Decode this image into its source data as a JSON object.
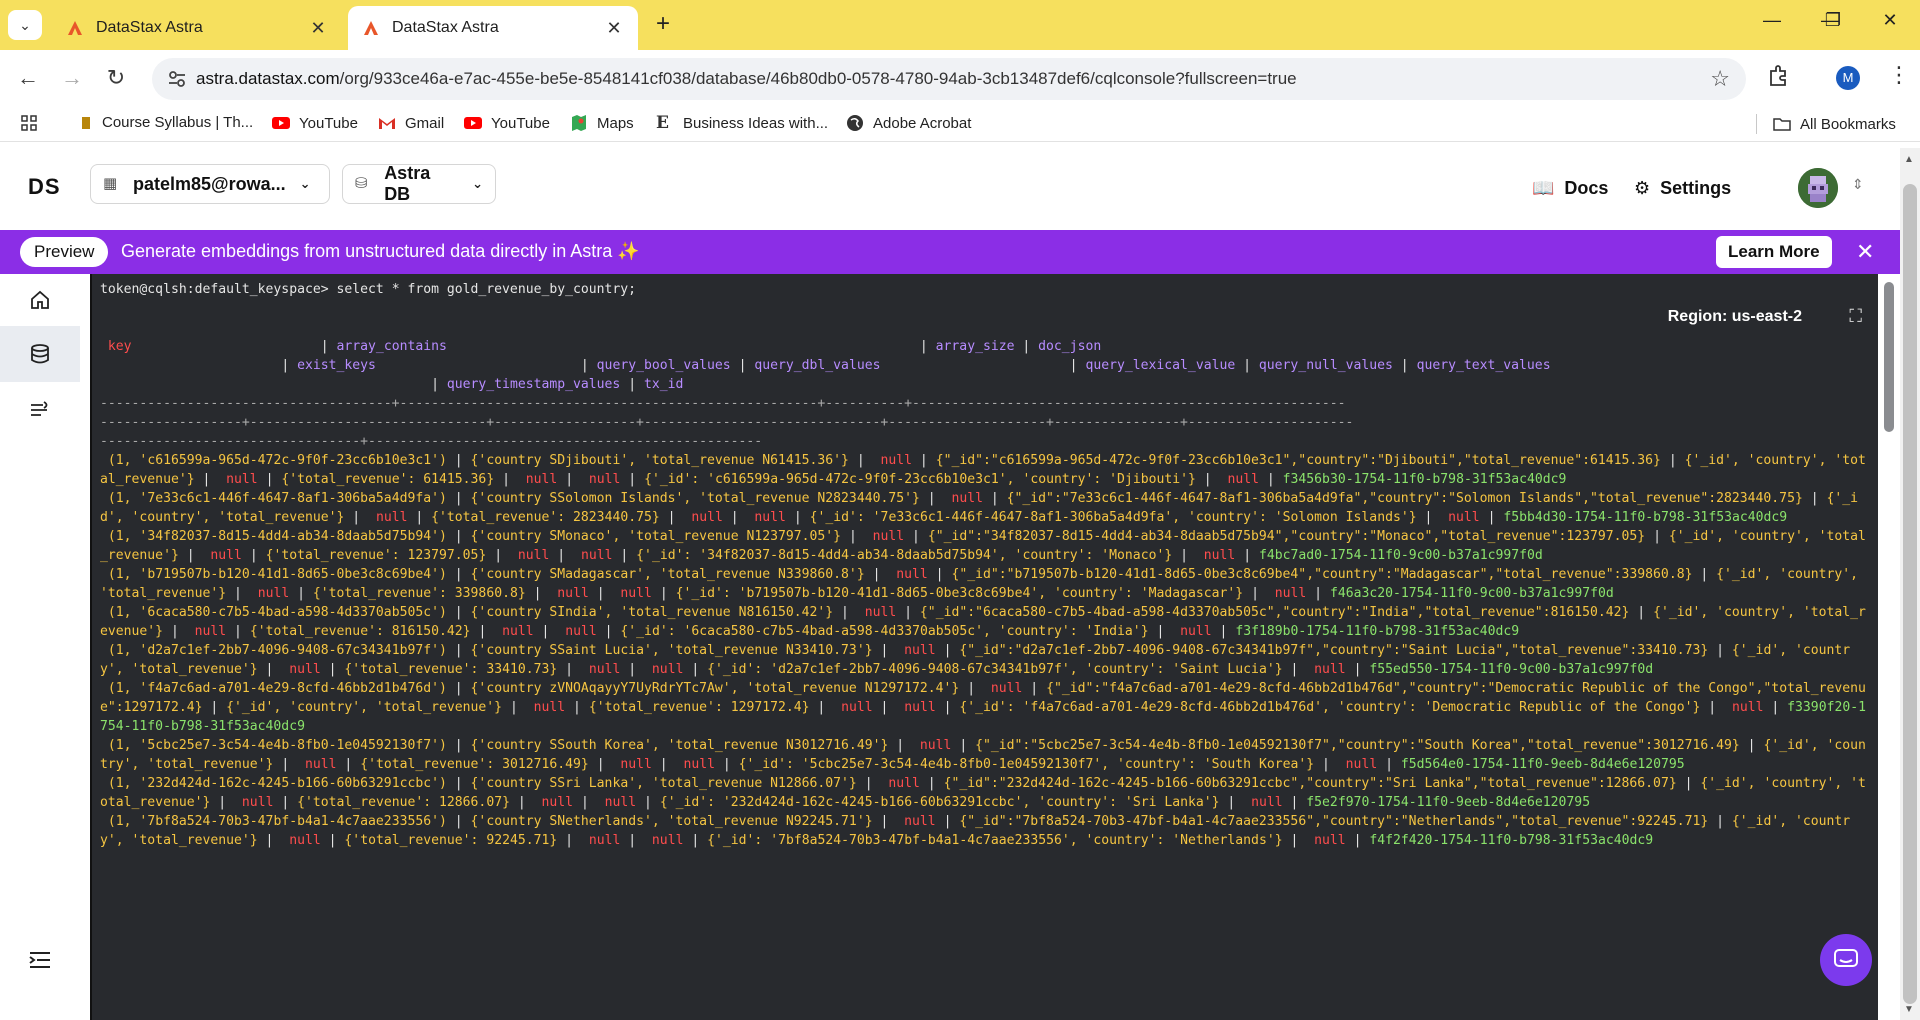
{
  "browser": {
    "tabs": [
      {
        "title": "DataStax Astra",
        "active": false
      },
      {
        "title": "DataStax Astra",
        "active": true
      }
    ],
    "url_host": "astra.datastax.com",
    "url_path": "/org/933ce46a-e7ac-455e-be5e-8548141cf038/database/46b80db0-0578-4780-94ab-3cb13487def6/cqlconsole?fullscreen=true",
    "profile_initial": "M",
    "bookmarks": [
      {
        "label": "Course Syllabus | Th..."
      },
      {
        "label": "YouTube"
      },
      {
        "label": "Gmail"
      },
      {
        "label": "YouTube"
      },
      {
        "label": "Maps"
      },
      {
        "label": "Business Ideas with..."
      },
      {
        "label": "Adobe Acrobat"
      }
    ],
    "all_bookmarks": "All Bookmarks"
  },
  "header": {
    "logo": "DS",
    "org_selector": "patelm85@rowa...",
    "db_selector": "Astra DB",
    "docs": "Docs",
    "settings": "Settings"
  },
  "banner": {
    "pill": "Preview",
    "message": "Generate embeddings from unstructured data directly in Astra ✨",
    "learn_more": "Learn More"
  },
  "console": {
    "region": "Region: us-east-2",
    "prompt": "token@cqlsh:default_keyspace>",
    "command": " select * from gold_revenue_by_country;",
    "columns": {
      "key": "key",
      "array_contains": "array_contains",
      "array_size": "array_size",
      "doc_json": "doc_json",
      "exist_keys": "exist_keys",
      "query_bool_values": "query_bool_values",
      "query_dbl_values": "query_dbl_values",
      "query_lexical_value": "query_lexical_value",
      "query_null_values": "query_null_values",
      "query_text_values": "query_text_values",
      "query_timestamp_values": "query_timestamp_values",
      "tx_id": "tx_id"
    },
    "null_text": "null",
    "rows": [
      {
        "id": "c616599a-965d-472c-9f0f-23cc6b10e3c1",
        "country": "Djibouti",
        "revenue": "61415.36",
        "tx": "f3456b30-1754-11f0-b798-31f53ac40dc9"
      },
      {
        "id": "7e33c6c1-446f-4647-8af1-306ba5a4d9fa",
        "country": "Solomon Islands",
        "revenue": "2823440.75",
        "tx": "f5bb4d30-1754-11f0-b798-31f53ac40dc9"
      },
      {
        "id": "34f82037-8d15-4dd4-ab34-8daab5d75b94",
        "country": "Monaco",
        "revenue": "123797.05",
        "tx": "f4bc7ad0-1754-11f0-9c00-b37a1c997f0d"
      },
      {
        "id": "b719507b-b120-41d1-8d65-0be3c8c69be4",
        "country": "Madagascar",
        "revenue": "339860.8",
        "tx": "f46a3c20-1754-11f0-9c00-b37a1c997f0d"
      },
      {
        "id": "6caca580-c7b5-4bad-a598-4d3370ab505c",
        "country": "India",
        "revenue": "816150.42",
        "tx": "f3f189b0-1754-11f0-b798-31f53ac40dc9"
      },
      {
        "id": "d2a7c1ef-2bb7-4096-9408-67c34341b97f",
        "country": "Saint Lucia",
        "revenue": "33410.73",
        "tx": "f55ed550-1754-11f0-9c00-b37a1c997f0d"
      },
      {
        "id": "f4a7c6ad-a701-4e29-8cfd-46bb2d1b476d",
        "country": "Democratic Republic of the Congo",
        "revenue": "1297172.4",
        "tx": "f3390f20-1754-11f0-b798-31f53ac40dc9",
        "contains_override": "country zVNOAqayyY7UyRdrYTc7Aw"
      },
      {
        "id": "5cbc25e7-3c54-4e4b-8fb0-1e04592130f7",
        "country": "South Korea",
        "revenue": "3012716.49",
        "tx": "f5d564e0-1754-11f0-9eeb-8d4e6e120795"
      },
      {
        "id": "232d424d-162c-4245-b166-60b63291ccbc",
        "country": "Sri Lanka",
        "revenue": "12866.07",
        "tx": "f5e2f970-1754-11f0-9eeb-8d4e6e120795"
      },
      {
        "id": "7bf8a524-70b3-47bf-b4a1-4c7aae233556",
        "country": "Netherlands",
        "revenue": "92245.71",
        "tx": "f4f2f420-1754-11f0-b798-31f53ac40dc9"
      }
    ]
  }
}
